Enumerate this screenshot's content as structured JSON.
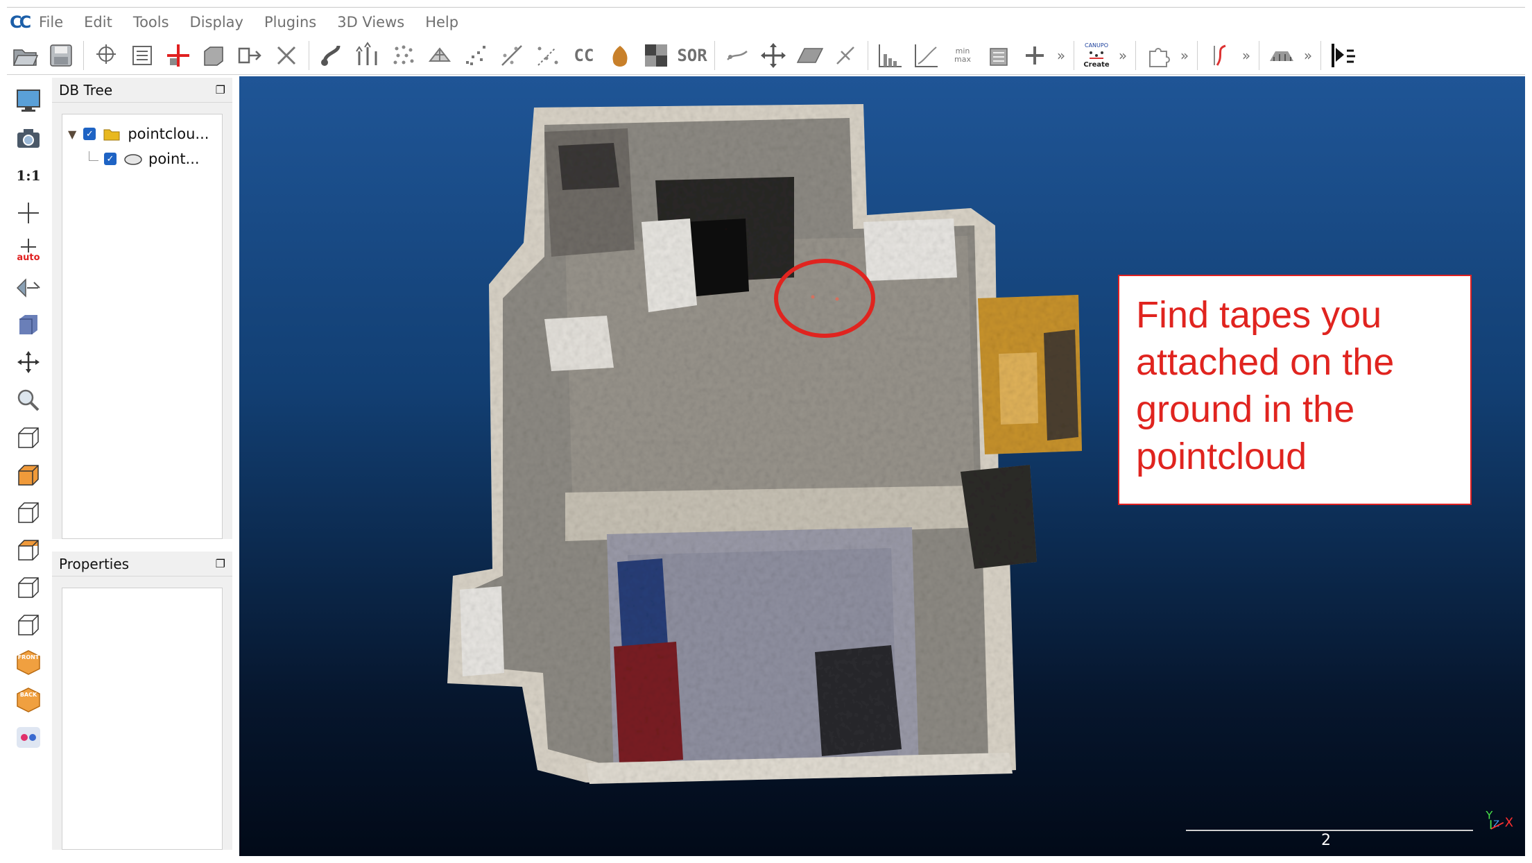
{
  "menubar": {
    "logo": "CC",
    "items": [
      "File",
      "Edit",
      "Tools",
      "Display",
      "Plugins",
      "3D Views",
      "Help"
    ]
  },
  "toolbar": {
    "text_buttons": {
      "cc": "CC",
      "sor": "SOR"
    },
    "canupo_label": "CANUPO",
    "canupo_sub": "Create",
    "minmax": "min max"
  },
  "left_toolbar": {
    "one_to_one": "1:1",
    "auto": "auto",
    "front": "FRONT",
    "back": "BACK"
  },
  "db_tree": {
    "title": "DB Tree",
    "items": [
      {
        "label": "pointclou...",
        "icon": "folder-icon",
        "checked": true
      },
      {
        "label": "point...",
        "icon": "cloud-icon",
        "checked": true
      }
    ]
  },
  "properties": {
    "title": "Properties"
  },
  "annotation": {
    "text_lines": [
      "Find tapes you",
      "attached on the",
      "ground in the",
      "pointcloud"
    ]
  },
  "scale": {
    "value": "2"
  },
  "axis": {
    "y": "Y",
    "z": "Z",
    "x": "X"
  },
  "colors": {
    "accent_red": "#e0241f",
    "viewport_top": "#1f5596",
    "viewport_bottom": "#020a18"
  }
}
